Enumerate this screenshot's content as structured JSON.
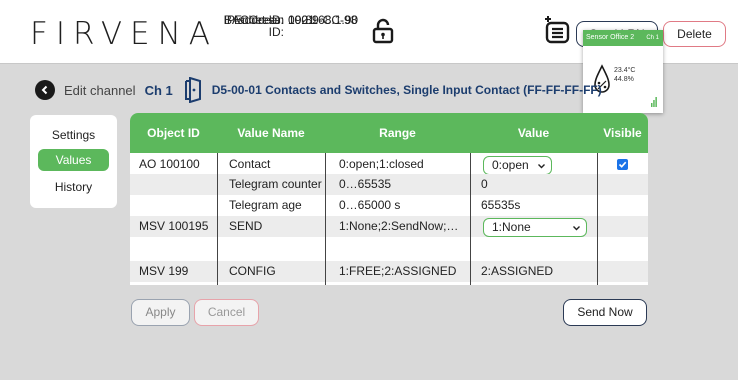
{
  "header": {
    "logo_text": "FIRVENA",
    "bacnet_label": "BACnet ID:",
    "bacnet_value": "1001",
    "enocean_label": "EnOcean ID:",
    "enocean_value": "00-89-CC-98",
    "ip_label": "IP address:",
    "ip_value": "192.168.1.90",
    "send_lrn_label": "Send LRN",
    "delete_label": "Delete"
  },
  "sensor_card": {
    "name": "Sensor Office 2",
    "channel": "Ch 1",
    "temperature": "23.4°C",
    "humidity": "44.8%"
  },
  "channel_bar": {
    "edit_label": "Edit channel",
    "channel_label": "Ch 1",
    "eep_description": "D5-00-01 Contacts and Switches, Single Input Contact (FF-FF-FF-FF)"
  },
  "menu": {
    "items": [
      {
        "label": "Settings",
        "active": false
      },
      {
        "label": "Values",
        "active": true
      },
      {
        "label": "History",
        "active": false
      }
    ]
  },
  "table": {
    "headers": [
      "Object ID",
      "Value Name",
      "Range",
      "Value",
      "Visible"
    ],
    "rows": [
      {
        "object_id": "AO 100100",
        "value_name": "Contact",
        "range": "0:open;1:closed",
        "value": "0:open",
        "value_type": "select",
        "visible": true
      },
      {
        "object_id": "",
        "value_name": "Telegram counter",
        "range": "0…65535",
        "value": "0",
        "value_type": "text",
        "visible": false
      },
      {
        "object_id": "",
        "value_name": "Telegram age",
        "range": "0…65000 s",
        "value": "65535s",
        "value_type": "text",
        "visible": false
      },
      {
        "object_id": "MSV 100195",
        "value_name": "SEND",
        "range": "1:None;2:SendNow;…",
        "value": "1:None",
        "value_type": "select",
        "visible": false
      },
      {
        "object_id": "",
        "value_name": "",
        "range": "",
        "value": "",
        "value_type": "text",
        "visible": false
      },
      {
        "object_id": "MSV 199",
        "value_name": "CONFIG",
        "range": "1:FREE;2:ASSIGNED",
        "value": "2:ASSIGNED",
        "value_type": "text",
        "visible": false
      }
    ]
  },
  "actions": {
    "apply_label": "Apply",
    "cancel_label": "Cancel",
    "send_now_label": "Send Now"
  },
  "colors": {
    "accent_green": "#5cb85c",
    "navy": "#1c3d6e",
    "delete_red": "#e07a85",
    "checkbox_blue": "#1a73e8"
  }
}
